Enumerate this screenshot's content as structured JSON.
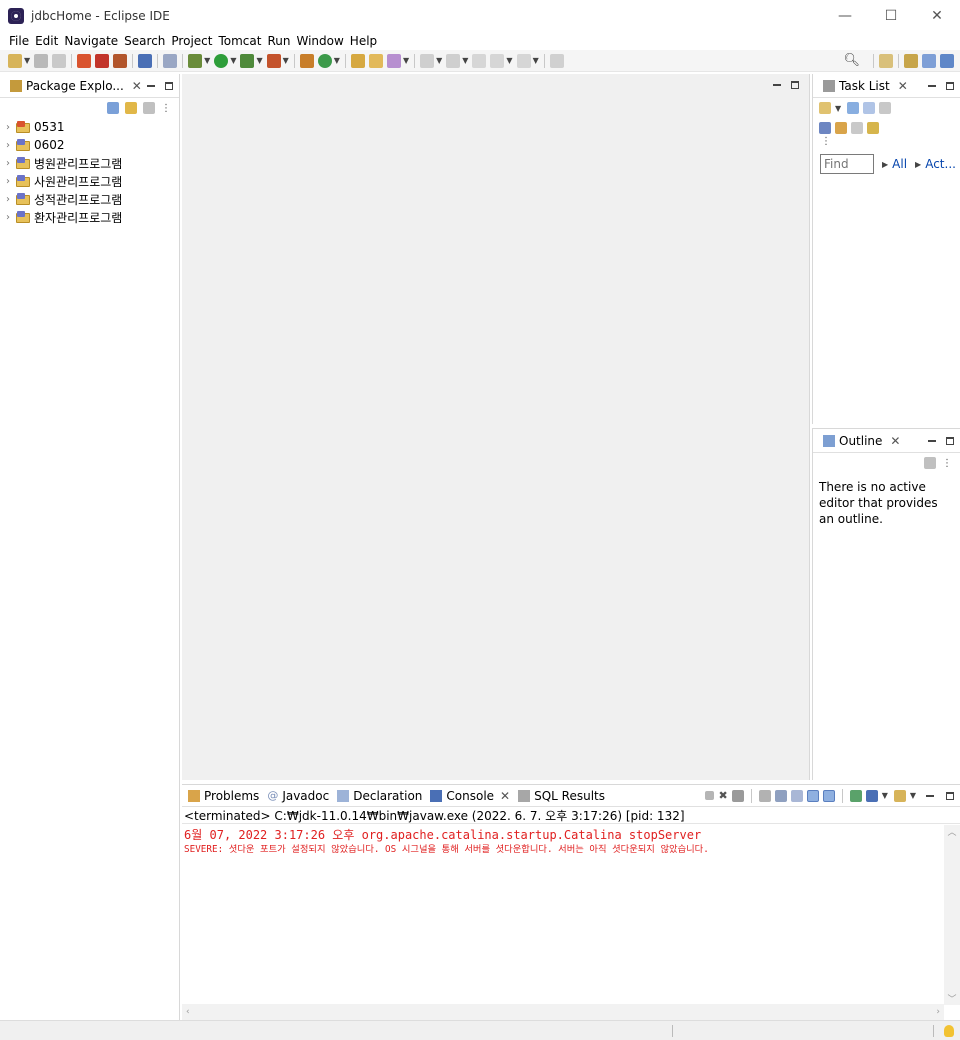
{
  "window": {
    "title": "jdbcHome - Eclipse IDE",
    "minimize": "—",
    "maximize": "☐",
    "close": "✕"
  },
  "menu": [
    "File",
    "Edit",
    "Navigate",
    "Search",
    "Project",
    "Tomcat",
    "Run",
    "Window",
    "Help"
  ],
  "package_explorer": {
    "tab_label": "Package Explo...",
    "close": "✕",
    "projects": [
      "0531",
      "0602",
      "병원관리프로그램",
      "사원관리프로그램",
      "성적관리프로그램",
      "환자관리프로그램"
    ]
  },
  "task_list": {
    "tab_label": "Task List",
    "close": "✕",
    "find_placeholder": "Find",
    "all_label": "All",
    "act_label": "Act..."
  },
  "outline": {
    "tab_label": "Outline",
    "close": "✕",
    "message": "There is no active editor that provides an outline."
  },
  "bottom_tabs": [
    {
      "label": "Problems"
    },
    {
      "label": "Javadoc"
    },
    {
      "label": "Declaration"
    },
    {
      "label": "Console"
    },
    {
      "label": "SQL Results"
    }
  ],
  "console": {
    "close": "✕",
    "status_line": "<terminated> C:₩jdk-11.0.14₩bin₩javaw.exe (2022. 6. 7. 오후 3:17:26) [pid: 132]",
    "line1": "6월 07, 2022 3:17:26 오후 org.apache.catalina.startup.Catalina stopServer",
    "line2": "SEVERE: 셧다운 포트가 설정되지 않았습니다. OS 시그널을 통해 서버를 셧다운합니다. 서버는 아직 셧다운되지 않았습니다.",
    "text_color": "#e02020"
  },
  "colors": {
    "editor_bg": "#f0f0f0",
    "link": "#0645ad",
    "folder": "#e7c15a"
  }
}
